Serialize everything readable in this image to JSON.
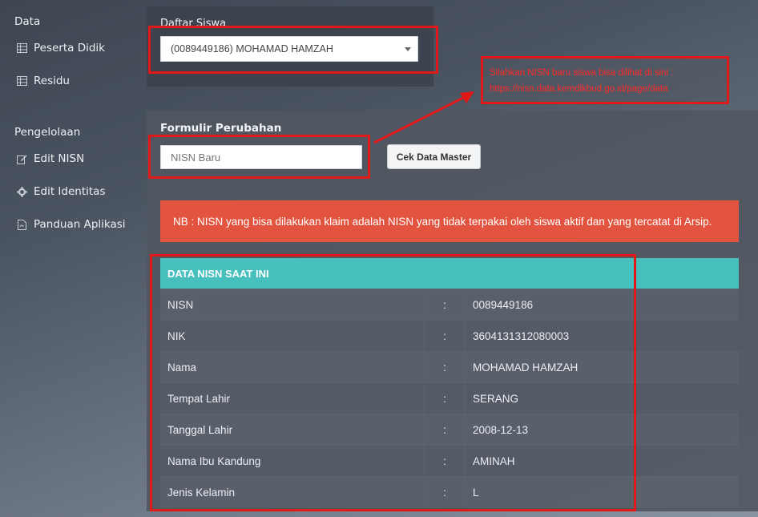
{
  "sidebar": {
    "section_data": "Data",
    "section_manage": "Pengelolaan",
    "items": [
      {
        "label": "Peserta Didik",
        "icon": "table-icon"
      },
      {
        "label": "Residu",
        "icon": "table-icon"
      },
      {
        "label": "Edit NISN",
        "icon": "edit-icon"
      },
      {
        "label": "Edit Identitas",
        "icon": "gear-icon"
      },
      {
        "label": "Panduan Aplikasi",
        "icon": "pdf-file-icon"
      }
    ]
  },
  "student_select": {
    "label": "Daftar Siswa",
    "value": "(0089449186) MOHAMAD HAMZAH"
  },
  "form": {
    "title": "Formulir Perubahan",
    "nisn_placeholder": "NISN Baru",
    "check_button": "Cek Data Master"
  },
  "alert": {
    "text": "NB : NISN yang bisa dilakukan klaim adalah NISN yang tidak terpakai oleh siswa aktif dan yang tercatat di Arsip."
  },
  "annotation": {
    "line1": "Silahkan NISN baru siswa bisa dilihat di sini :",
    "line2": "https://nisn.data.kemdikbud.go.id/page/data"
  },
  "nisn_table": {
    "header": "DATA NISN SAAT INI",
    "separator": ":",
    "rows": [
      {
        "field": "NISN",
        "value": "0089449186"
      },
      {
        "field": "NIK",
        "value": "3604131312080003"
      },
      {
        "field": "Nama",
        "value": "MOHAMAD HAMZAH"
      },
      {
        "field": "Tempat Lahir",
        "value": "SERANG"
      },
      {
        "field": "Tanggal Lahir",
        "value": "2008-12-13"
      },
      {
        "field": "Nama Ibu Kandung",
        "value": "AMINAH"
      },
      {
        "field": "Jenis Kelamin",
        "value": "L"
      }
    ]
  },
  "colors": {
    "accent_teal": "#47bfbd",
    "alert_red": "#e2543f",
    "annotation_red": "#e01818"
  }
}
